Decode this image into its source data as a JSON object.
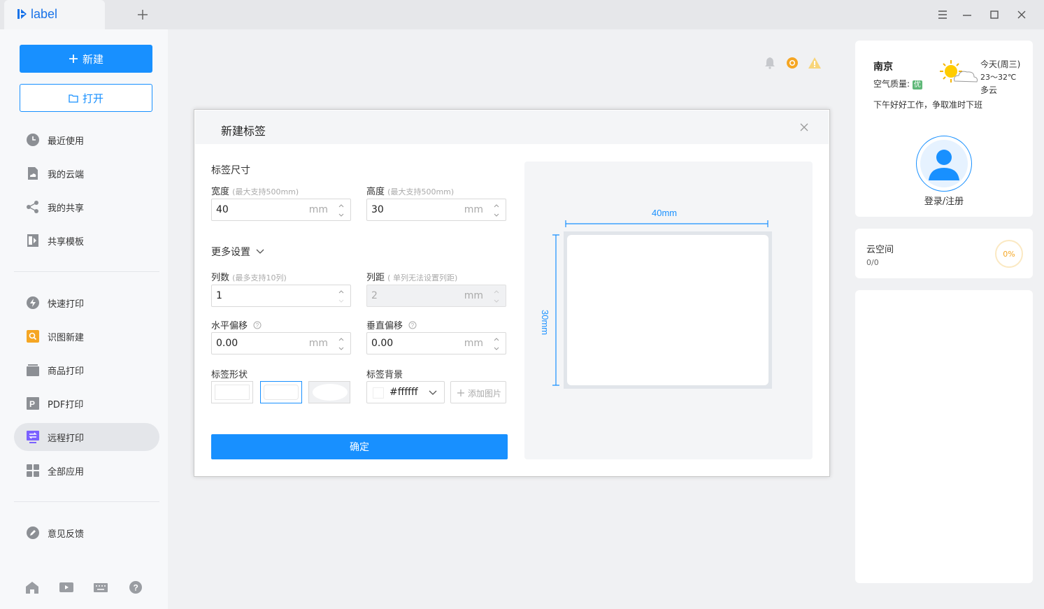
{
  "app": {
    "logo_text": "label",
    "brand_color": "#1890ff"
  },
  "titlebar": {
    "icons": [
      "plus-icon",
      "menu-icon",
      "minimize-icon",
      "maximize-icon",
      "close-icon"
    ]
  },
  "sidebar": {
    "new_label": "新建",
    "open_label": "打开",
    "items": [
      {
        "label": "最近使用",
        "icon": "clock-icon"
      },
      {
        "label": "我的云端",
        "icon": "cloud-file-icon"
      },
      {
        "label": "我的共享",
        "icon": "share-icon"
      },
      {
        "label": "共享模板",
        "icon": "template-icon"
      },
      {
        "label": "快速打印",
        "icon": "lightning-icon"
      },
      {
        "label": "识图新建",
        "icon": "image-search-icon"
      },
      {
        "label": "商品打印",
        "icon": "product-icon"
      },
      {
        "label": "PDF打印",
        "icon": "pdf-icon"
      },
      {
        "label": "远程打印",
        "icon": "remote-print-icon",
        "active": true
      },
      {
        "label": "全部应用",
        "icon": "apps-grid-icon"
      },
      {
        "label": "意见反馈",
        "icon": "feedback-icon"
      }
    ],
    "bottom_icons": [
      "home-icon",
      "video-icon",
      "keyboard-icon",
      "help-icon"
    ]
  },
  "dialog": {
    "title": "新建标签",
    "size_section": "标签尺寸",
    "width": {
      "label": "宽度",
      "hint": "(最大支持500mm)",
      "value": "40",
      "unit": "mm"
    },
    "height": {
      "label": "高度",
      "hint": "(最大支持500mm)",
      "value": "30",
      "unit": "mm"
    },
    "more_settings": "更多设置",
    "columns": {
      "label": "列数",
      "hint": "(最多支持10列)",
      "value": "1"
    },
    "column_gap": {
      "label": "列距",
      "hint": "( 单列无法设置列距)",
      "value": "2",
      "unit": "mm"
    },
    "h_offset": {
      "label": "水平偏移",
      "value": "0.00",
      "unit": "mm"
    },
    "v_offset": {
      "label": "垂直偏移",
      "value": "0.00",
      "unit": "mm"
    },
    "shape": {
      "label": "标签形状",
      "options": [
        "rectangle",
        "rounded-rectangle",
        "ellipse"
      ],
      "selected": 1
    },
    "background": {
      "label": "标签背景",
      "color": "#ffffff",
      "add_image": "添加图片"
    },
    "confirm": "确定",
    "preview": {
      "width_label": "40mm",
      "height_label": "30mm"
    }
  },
  "weather": {
    "city": "南京",
    "air_quality_label": "空气质量:",
    "air_quality_value": "优",
    "day": "今天(周三)",
    "temp": "23～32℃",
    "condition": "多云",
    "greeting": "下午好好工作，争取准时下班",
    "login": "登录/注册"
  },
  "cloud": {
    "title": "云空间",
    "usage": "0/0",
    "percent": "0%"
  }
}
